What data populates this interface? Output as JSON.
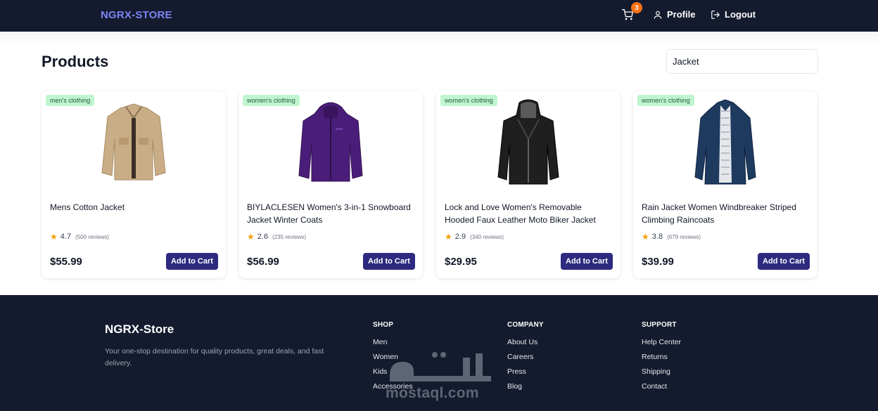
{
  "header": {
    "brand": "NGRX-STORE",
    "cart_count": "3",
    "profile_label": "Profile",
    "logout_label": "Logout"
  },
  "main": {
    "title": "Products",
    "search": {
      "value": "Jacket",
      "placeholder": ""
    },
    "add_to_cart_label": "Add to Cart",
    "products": [
      {
        "category": "men's clothing",
        "title": "Mens Cotton Jacket",
        "rating": "4.7",
        "reviews": "(500 reviews)",
        "price": "$55.99",
        "image_icon": "beige-cotton-jacket-image",
        "image_color": "#c9ad86"
      },
      {
        "category": "women's clothing",
        "title": "BIYLACLESEN Women's 3-in-1 Snowboard Jacket Winter Coats",
        "rating": "2.6",
        "reviews": "(235 reviews)",
        "price": "$56.99",
        "image_icon": "purple-snowboard-jacket-image",
        "image_color": "#4b1d7a"
      },
      {
        "category": "women's clothing",
        "title": "Lock and Love Women's Removable Hooded Faux Leather Moto Biker Jacket",
        "rating": "2.9",
        "reviews": "(340 reviews)",
        "price": "$29.95",
        "image_icon": "black-leather-biker-jacket-image",
        "image_color": "#1f1f1f"
      },
      {
        "category": "women's clothing",
        "title": "Rain Jacket Women Windbreaker Striped Climbing Raincoats",
        "rating": "3.8",
        "reviews": "(679 reviews)",
        "price": "$39.99",
        "image_icon": "navy-rain-jacket-image",
        "image_color": "#1e3a5f"
      }
    ]
  },
  "footer": {
    "brand": "NGRX-Store",
    "tagline": "Your one-stop destination for quality products, great deals, and fast delivery.",
    "columns": [
      {
        "heading": "SHOP",
        "links": [
          "Men",
          "Women",
          "Kids",
          "Accessories"
        ]
      },
      {
        "heading": "COMPANY",
        "links": [
          "About Us",
          "Careers",
          "Press",
          "Blog"
        ]
      },
      {
        "heading": "SUPPORT",
        "links": [
          "Help Center",
          "Returns",
          "Shipping",
          "Contact"
        ]
      }
    ],
    "watermark": {
      "arabic": "مستقل",
      "latin": "mostaql.com"
    }
  },
  "colors": {
    "nav_bg": "#141b2e",
    "brand": "#7c83f5",
    "button": "#2e2a7f",
    "badge_bg": "#bff5cf",
    "cart_badge": "#f97316",
    "star": "#f59e0b"
  }
}
